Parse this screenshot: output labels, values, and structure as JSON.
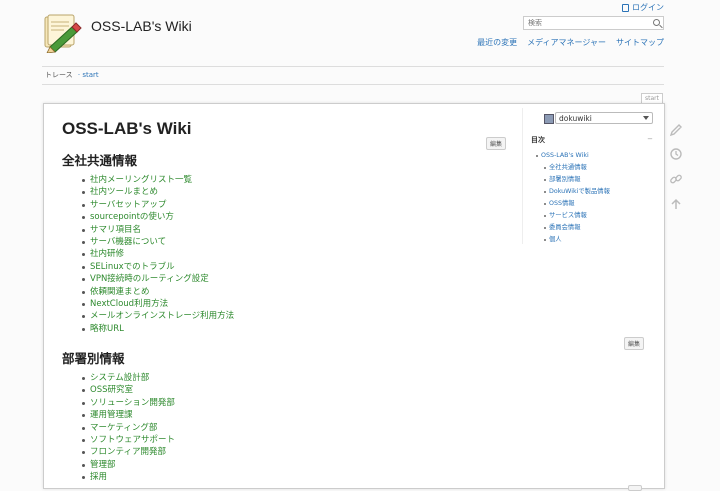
{
  "header": {
    "site_title": "OSS-LAB's Wiki",
    "login_label": "ログイン",
    "search_placeholder": "検索",
    "user_tools": [
      "最近の変更",
      "メディアマネージャー",
      "サイトマップ"
    ]
  },
  "breadcrumb": {
    "label": "トレース",
    "crumb": "· start"
  },
  "page": {
    "id": "start",
    "title": "OSS-LAB's Wiki",
    "edit_label": "編集",
    "sections": [
      {
        "heading": "全社共通情報",
        "items": [
          "社内メーリングリスト一覧",
          "社内ツールまとめ",
          "サーバセットアップ",
          "sourcepointの使い方",
          "サマリ項目名",
          "サーバ機器について",
          "社内研修",
          "SELinuxでのトラブル",
          "VPN接続時のルーティング設定",
          "依頼関連まとめ",
          "NextCloud利用方法",
          "メールオンラインストレージ利用方法",
          "略称URL"
        ]
      },
      {
        "heading": "部署別情報",
        "items": [
          "システム設計部",
          "OSS研究室",
          "ソリューション開発部",
          "運用管理課",
          "マーケティング部",
          "ソフトウェアサポート",
          "フロンティア開発部",
          "管理部",
          "採用"
        ]
      }
    ]
  },
  "toc": {
    "selector_value": "dokuwiki",
    "title": "目次",
    "collapse": "−",
    "items": [
      {
        "label": "OSS-LAB's Wiki",
        "level": 1
      },
      {
        "label": "全社共通情報",
        "level": 2
      },
      {
        "label": "部署別情報",
        "level": 2
      },
      {
        "label": "DokuWikiで製品情報",
        "level": 2
      },
      {
        "label": "OSS情報",
        "level": 2
      },
      {
        "label": "サービス情報",
        "level": 2
      },
      {
        "label": "委員会情報",
        "level": 2
      },
      {
        "label": "個人",
        "level": 2
      }
    ]
  },
  "page_tools": [
    "pencil-icon",
    "history-icon",
    "link-icon",
    "arrow-up-icon"
  ],
  "colors": {
    "link": "#2b73b7",
    "wikilink": "#2e8a2e"
  }
}
